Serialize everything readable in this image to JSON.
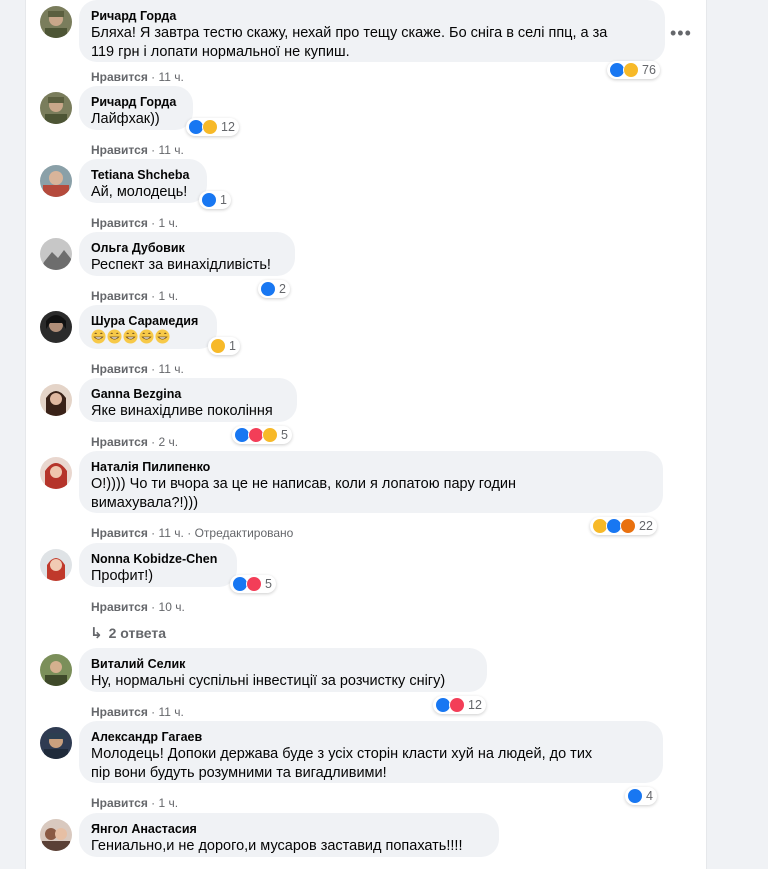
{
  "actions": {
    "like_label": "Нравится",
    "separator": "·",
    "edited_label": "Отредактировано"
  },
  "reaction_colors": {
    "like": "#1877f2",
    "love": "#f33e58",
    "haha": "#f7b928",
    "angry": "#e9710f"
  },
  "comments": [
    {
      "author": "Ричард Горда",
      "lines": [
        "Бляха! Я завтра тестю скажу, нехай про тещу скаже. Бо сніга в селі ппц, а за",
        "119 грн і лопати нормальної не купиш."
      ],
      "time": "11 ч.",
      "reactions": [
        "like",
        "haha"
      ],
      "count": "76"
    },
    {
      "author": "Ричард Горда",
      "lines": [
        "Лайфхак))"
      ],
      "time": "11 ч.",
      "reactions": [
        "like",
        "haha"
      ],
      "count": "12"
    },
    {
      "author": "Tetiana Shcheba",
      "lines": [
        "Ай, молодець!"
      ],
      "time": "1 ч.",
      "reactions": [
        "like"
      ],
      "count": "1"
    },
    {
      "author": "Ольга Дубовик",
      "lines": [
        "Респект за винахідливість!"
      ],
      "time": "1 ч.",
      "reactions": [
        "like"
      ],
      "count": "2"
    },
    {
      "author": "Шура Сарамедия",
      "lines": [
        ""
      ],
      "emoji_count": 5,
      "time": "11 ч.",
      "reactions": [
        "haha"
      ],
      "count": "1"
    },
    {
      "author": "Ganna Bezgina",
      "lines": [
        "Яке винахідливе покоління"
      ],
      "time": "2 ч.",
      "reactions": [
        "like",
        "love",
        "haha"
      ],
      "count": "5"
    },
    {
      "author": "Наталія Пилипенко",
      "lines": [
        "О!)))) Чо ти вчора за це не написав, коли я лопатою пару годин",
        "вимахувала?!)))"
      ],
      "time": "11 ч.",
      "edited": true,
      "reactions": [
        "haha",
        "like",
        "angry"
      ],
      "count": "22"
    },
    {
      "author": "Nonna Kobidze-Chen",
      "lines": [
        "Профит!)"
      ],
      "time": "10 ч.",
      "reactions": [
        "like",
        "love"
      ],
      "count": "5"
    },
    {
      "author": "Виталий Селик",
      "lines": [
        "Ну, нормальні суспільні інвестиції за розчистку снігу)"
      ],
      "time": "11 ч.",
      "reactions": [
        "like",
        "love"
      ],
      "count": "12"
    },
    {
      "author": "Александр Гагаев",
      "lines": [
        "Молодець! Допоки держава буде з усіх сторін класти хуй на людей, до тих",
        "пір вони будуть розумними та вигадливими!"
      ],
      "time": "1 ч.",
      "reactions": [
        "like"
      ],
      "count": "4"
    },
    {
      "author": "Янгол Анастасия",
      "lines": [
        "Гениально,и не дорого,и мусаров заставид попахать!!!!"
      ],
      "time": "",
      "reactions": [],
      "count": ""
    }
  ],
  "replies_link": "2 ответа",
  "more_icon": "more-horizontal-icon"
}
